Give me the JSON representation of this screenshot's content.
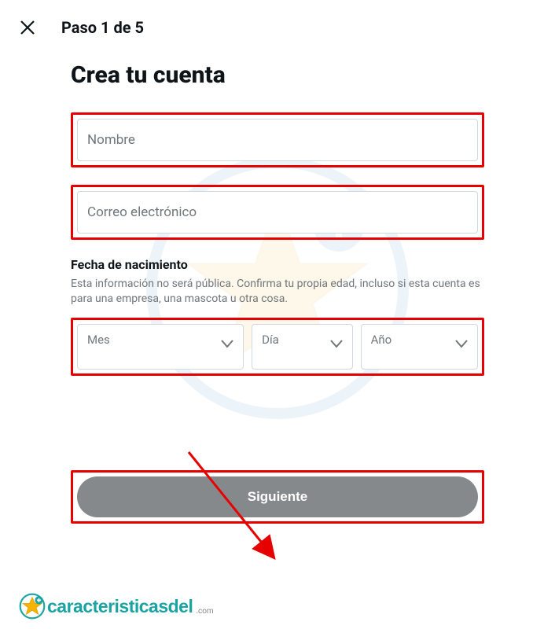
{
  "header": {
    "step": "Paso 1 de 5"
  },
  "title": "Crea tu cuenta",
  "fields": {
    "name_label": "Nombre",
    "email_label": "Correo electrónico"
  },
  "dob": {
    "title": "Fecha de nacimiento",
    "desc": "Esta información no será pública. Confirma tu propia edad, incluso si esta cuenta es para una empresa, una mascota u otra cosa.",
    "month": "Mes",
    "day": "Día",
    "year": "Año"
  },
  "next_button": "Siguiente",
  "footer": {
    "brand": "caracteristicasdel",
    "tld": ".com"
  }
}
